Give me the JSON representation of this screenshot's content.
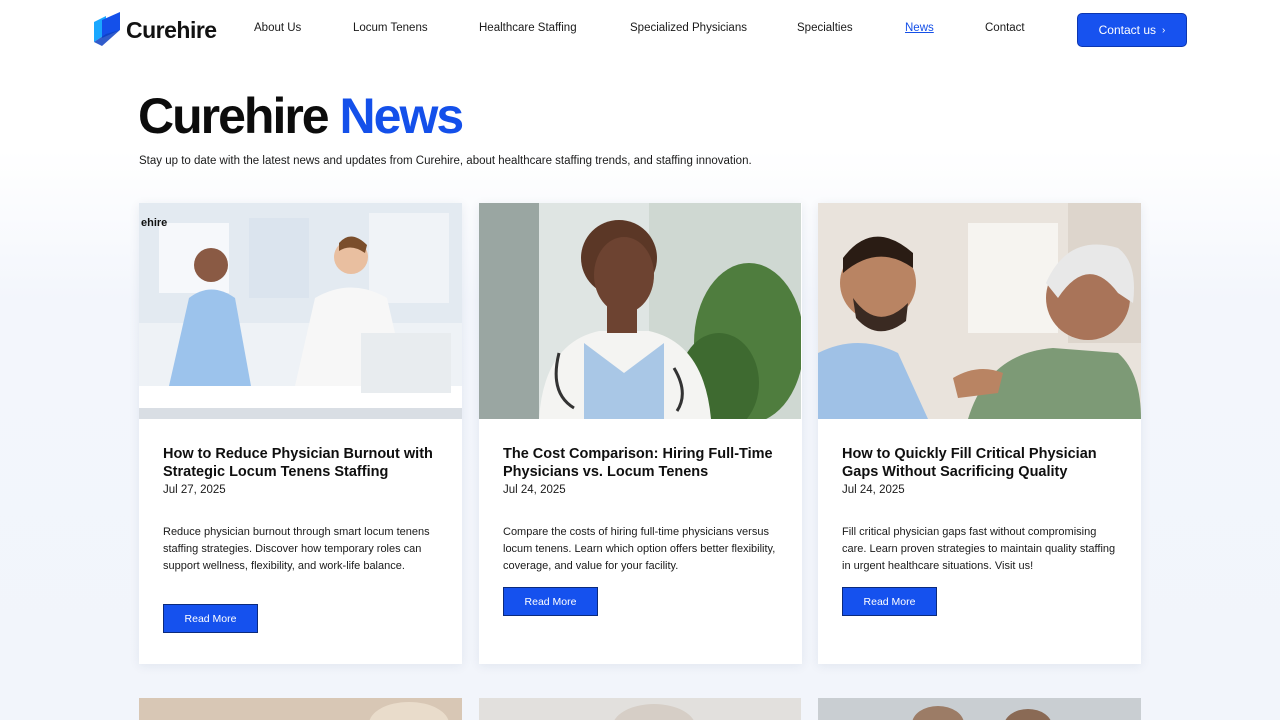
{
  "brand": {
    "name": "Curehire",
    "color": "#1450ea"
  },
  "nav": [
    {
      "label": "About Us",
      "active": false
    },
    {
      "label": "Locum Tenens",
      "active": false
    },
    {
      "label": "Healthcare Staffing",
      "active": false
    },
    {
      "label": "Specialized Physicians",
      "active": false
    },
    {
      "label": "Specialties",
      "active": false
    },
    {
      "label": "News",
      "active": true
    },
    {
      "label": "Contact",
      "active": false
    }
  ],
  "cta": {
    "label": "Contact us",
    "icon": "chevron-right-icon"
  },
  "hero": {
    "title_brand": "Curehire",
    "title_accent": "News",
    "subtitle": "Stay up to date with the latest news and updates from Curehire, about healthcare staffing trends, and staffing innovation."
  },
  "cards": [
    {
      "image_label": "ehire",
      "title": "How to Reduce Physician Burnout with Strategic Locum Tenens Staffing",
      "date": "Jul 27, 2025",
      "description": "Reduce physician burnout through smart locum tenens staffing strategies. Discover how temporary roles can support wellness, flexibility, and work-life balance.",
      "button": "Read More"
    },
    {
      "title": "The Cost Comparison: Hiring Full-Time Physicians vs. Locum Tenens",
      "date": "Jul 24, 2025",
      "description": "Compare the costs of hiring full-time physicians versus locum tenens. Learn which option offers better flexibility, coverage, and value for your facility.",
      "button": "Read More"
    },
    {
      "title": "How to Quickly Fill Critical Physician Gaps Without Sacrificing Quality",
      "date": "Jul 24, 2025",
      "description": "Fill critical physician gaps fast without compromising care. Learn proven strategies to maintain quality staffing in urgent healthcare situations. Visit us!",
      "button": "Read More"
    }
  ]
}
